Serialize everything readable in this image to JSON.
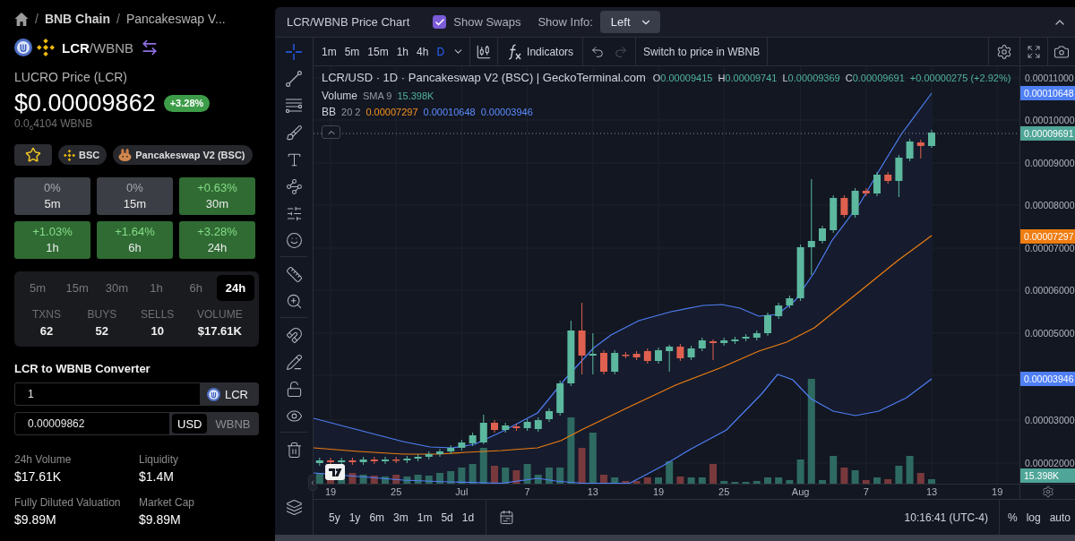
{
  "breadcrumb": [
    {
      "separator": "/",
      "label": "BNB Chain",
      "current": false
    },
    {
      "separator": "/",
      "label": "Pancakeswap V...",
      "current": true
    }
  ],
  "pair": {
    "name": "**LCR**/WBNB"
  },
  "price": {
    "title": "LUCRO Price (LCR)",
    "usd": "$0.00009862",
    "change": "+3.28%",
    "native": "0.0$_{6}$4104 WBNB"
  },
  "chips": [
    {
      "kind": "network",
      "label": "BSC"
    },
    {
      "kind": "dex",
      "label": "Pancakeswap V2 (BSC)"
    }
  ],
  "changes": [
    {
      "value": "0%",
      "period": "5m",
      "kind": "neutral"
    },
    {
      "value": "0%",
      "period": "15m",
      "kind": "neutral"
    },
    {
      "value": "+0.63%",
      "period": "30m",
      "kind": "positive"
    },
    {
      "value": "+1.03%",
      "period": "1h",
      "kind": "positive"
    },
    {
      "value": "+1.64%",
      "period": "6h",
      "kind": "positive"
    },
    {
      "value": "+3.28%",
      "period": "24h",
      "kind": "positive"
    }
  ],
  "stats": {
    "tabs": [
      {
        "label": "5m",
        "selected": false
      },
      {
        "label": "15m",
        "selected": false
      },
      {
        "label": "30m",
        "selected": false
      },
      {
        "label": "1h",
        "selected": false
      },
      {
        "label": "6h",
        "selected": false
      },
      {
        "label": "24h",
        "selected": true
      }
    ],
    "metrics": [
      {
        "label": "TXNS",
        "value": "62"
      },
      {
        "label": "BUYS",
        "value": "52"
      },
      {
        "label": "SELLS",
        "value": "10"
      },
      {
        "label": "VOLUME",
        "value": "$17.61K"
      }
    ]
  },
  "converter": {
    "title": "LCR to WBNB Converter",
    "from": {
      "value": "1",
      "token": "LCR"
    },
    "to": {
      "value": "0.00009862",
      "units": [
        {
          "label": "USD",
          "selected": true
        },
        {
          "label": "WBNB",
          "selected": false
        }
      ]
    }
  },
  "market": [
    {
      "label": "24h Volume",
      "value": "$17.61K"
    },
    {
      "label": "Liquidity",
      "value": "$1.4M"
    },
    {
      "label": "Fully Diluted Valuation",
      "value": "$9.89M"
    },
    {
      "label": "Market Cap",
      "value": "$9.89M"
    }
  ],
  "chart_panel": {
    "title": "LCR/WBNB Price Chart",
    "show_swaps": {
      "label": "Show Swaps",
      "checked": true
    },
    "show_info": {
      "label": "Show Info:",
      "value": "Left"
    }
  },
  "drawing_tools": [
    {
      "tools": [
        {
          "kind": "crosshair",
          "selected": true
        },
        {
          "kind": "trend-line",
          "selected": false
        },
        {
          "kind": "fib",
          "selected": false
        },
        {
          "kind": "brush",
          "selected": false
        },
        {
          "kind": "text",
          "selected": false
        },
        {
          "kind": "pattern",
          "selected": false
        },
        {
          "kind": "projection",
          "selected": false
        },
        {
          "kind": "emoji",
          "selected": false
        }
      ]
    },
    {
      "tools": [
        {
          "kind": "ruler",
          "selected": false
        },
        {
          "kind": "zoom",
          "selected": false
        }
      ]
    },
    {
      "tools": [
        {
          "kind": "magnet",
          "selected": false
        },
        {
          "kind": "lock-drawings",
          "selected": false
        },
        {
          "kind": "lock",
          "selected": false
        },
        {
          "kind": "hide",
          "selected": false
        }
      ]
    },
    {
      "tools": [
        {
          "kind": "trash",
          "selected": false
        }
      ]
    }
  ],
  "toolbar": {
    "intervals": [
      {
        "label": "1m",
        "selected": false
      },
      {
        "label": "5m",
        "selected": false
      },
      {
        "label": "15m",
        "selected": false
      },
      {
        "label": "1h",
        "selected": false
      },
      {
        "label": "4h",
        "selected": false
      },
      {
        "label": "D",
        "selected": true
      }
    ],
    "indicators": "Indicators",
    "switch_price": "Switch to price in WBNB"
  },
  "legend": {
    "symbol": "LCR/USD · 1D · Pancakeswap V2 (BSC) | GeckoTerminal.com",
    "ohlc": [
      {
        "label": "O",
        "value": "0.00009415"
      },
      {
        "label": "H",
        "value": "0.00009741"
      },
      {
        "label": "L",
        "value": "0.00009369"
      },
      {
        "label": "C",
        "value": "0.00009691"
      }
    ],
    "change": "+0.00000275 (+2.92%)",
    "volume": {
      "name": "Volume",
      "params": "SMA 9",
      "value": "15.398K"
    },
    "bb": {
      "name": "BB",
      "params": "20 2",
      "values": [
        {
          "value": "0.00007297",
          "color": "#f7931e"
        },
        {
          "value": "0.00010648",
          "color": "#5b8cff"
        },
        {
          "value": "0.00003946",
          "color": "#5b8cff"
        }
      ]
    }
  },
  "price_axis": {
    "ticks": [
      "0.00011000",
      "0.00010000",
      "0.00009000",
      "0.00008000",
      "0.00007000",
      "0.00006000",
      "0.00005000",
      "0.00003000",
      "0.00002000"
    ],
    "tags": [
      {
        "value": "0.00010648",
        "color": "#4f7ff5"
      },
      {
        "value": "0.00009691",
        "color": "#4fa597"
      },
      {
        "value": "0.00007297",
        "color": "#ef7d12"
      },
      {
        "value": "0.00003946",
        "color": "#4f7ff5"
      },
      {
        "value": "15.398K",
        "color": "#4fa597"
      }
    ]
  },
  "time_axis": [
    "19",
    "25",
    "Jul",
    "7",
    "13",
    "19",
    "25",
    "Aug",
    "7",
    "13",
    "19"
  ],
  "range_bar": {
    "ranges": [
      "5y",
      "1y",
      "6m",
      "3m",
      "1m",
      "5d",
      "1d"
    ],
    "clock": "10:16:41 (UTC-4)",
    "scales": [
      "%",
      "log",
      "auto"
    ]
  }
}
